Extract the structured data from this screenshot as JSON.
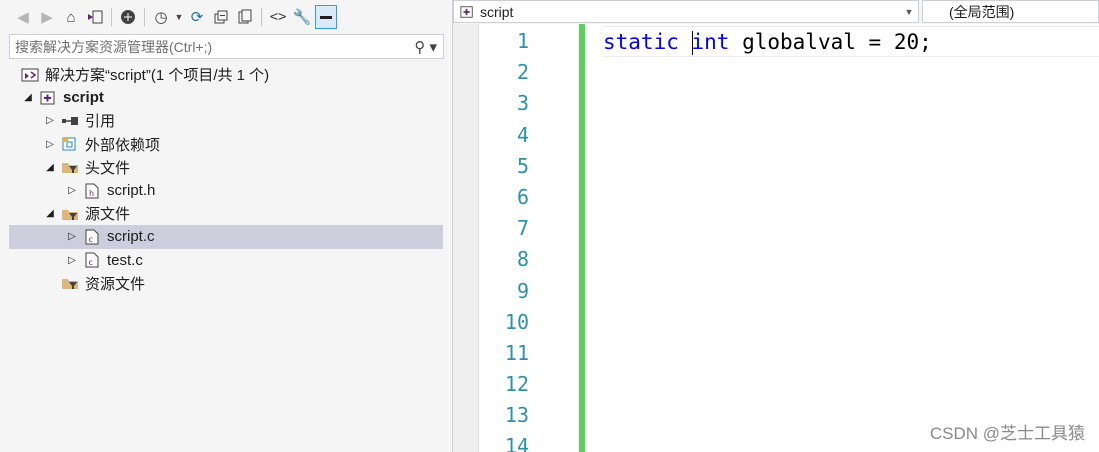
{
  "explorer": {
    "search_placeholder": "搜索解决方案资源管理器(Ctrl+;)",
    "tree": [
      {
        "label": "解决方案“script”(1 个项目/共 1 个)",
        "icon": "solution-icon",
        "expand": ""
      },
      {
        "label": "script",
        "icon": "project-icon",
        "expand": "◢",
        "bold": true
      },
      {
        "label": "引用",
        "icon": "references-icon",
        "expand": "▷"
      },
      {
        "label": "外部依赖项",
        "icon": "external-deps-icon",
        "expand": "▷"
      },
      {
        "label": "头文件",
        "icon": "folder-filter-icon",
        "expand": "◢"
      },
      {
        "label": "script.h",
        "icon": "header-file-icon",
        "expand": "▷"
      },
      {
        "label": "源文件",
        "icon": "folder-filter-icon",
        "expand": "◢"
      },
      {
        "label": "script.c",
        "icon": "c-file-icon",
        "expand": "▷",
        "selected": true
      },
      {
        "label": "test.c",
        "icon": "c-file-icon",
        "expand": "▷"
      },
      {
        "label": "资源文件",
        "icon": "folder-filter-icon",
        "expand": ""
      }
    ]
  },
  "editor": {
    "nav_project": "script",
    "nav_scope": "(全局范围)",
    "line_numbers": [
      "1",
      "2",
      "3",
      "4",
      "5",
      "6",
      "7",
      "8",
      "9",
      "10",
      "11",
      "12",
      "13",
      "14"
    ],
    "code": {
      "kw1": "static",
      "kw2": "int",
      "rest": " globalval = 20;"
    }
  },
  "watermark": "CSDN @芝士工具猿",
  "colors": {
    "keyword": "#0000ff",
    "line_number": "#2b91af",
    "change_bar": "#57d357",
    "selection": "#cccedb"
  }
}
